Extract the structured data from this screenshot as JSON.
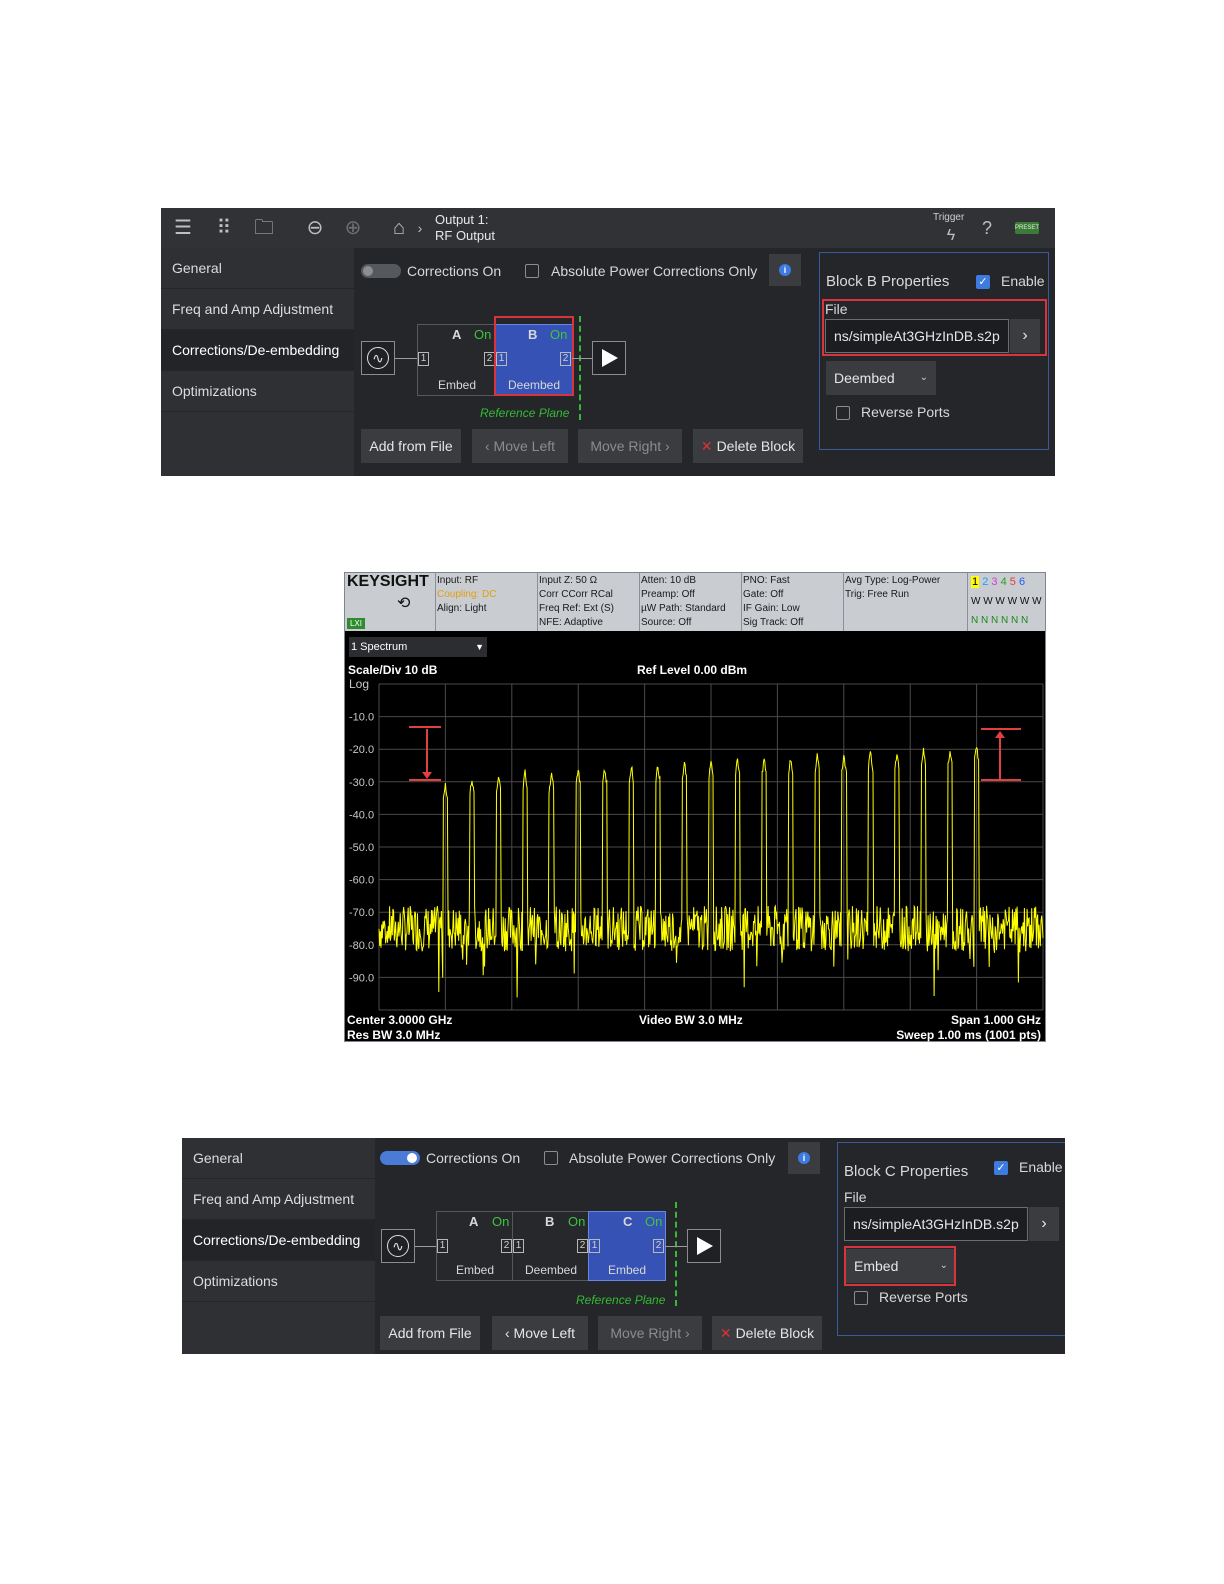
{
  "panel1": {
    "topbar": {
      "output_line1": "Output 1:",
      "output_line2": "RF Output",
      "trigger_label": "Trigger",
      "help_glyph": "?",
      "preset_label": "PRESET"
    },
    "side_items": [
      "General",
      "Freq and Amp Adjustment",
      "Corrections/De-embedding",
      "Optimizations"
    ],
    "corrections_on_label": "Corrections On",
    "corrections_on": false,
    "abs_power_label": "Absolute Power Corrections Only",
    "info_glyph": "i",
    "blocks": [
      {
        "letter": "A",
        "status": "On",
        "mode": "Embed",
        "port_in": "1",
        "port_out": "2"
      },
      {
        "letter": "B",
        "status": "On",
        "mode": "Deembed",
        "port_in": "1",
        "port_out": "2"
      }
    ],
    "reference_plane": "Reference Plane",
    "buttons": {
      "add": "Add from File",
      "move_left": "Move Left",
      "move_right": "Move Right",
      "delete": "Delete Block"
    },
    "props": {
      "title": "Block B Properties",
      "enable_label": "Enable",
      "file_label": "File",
      "file_value": "ns/simpleAt3GHzInDB.s2p",
      "mode_value": "Deembed",
      "reverse_label": "Reverse Ports"
    }
  },
  "spectrum": {
    "brand": "KEYSIGHT",
    "lxi": "LXI",
    "col1": [
      "Input: RF",
      "Coupling: DC",
      "Align: Light"
    ],
    "col2": [
      "Input Z: 50 Ω",
      "Corr CCorr RCal",
      "Freq Ref: Ext (S)",
      "NFE: Adaptive"
    ],
    "col3": [
      "Atten: 10 dB",
      "Preamp: Off",
      "µW Path: Standard",
      "Source: Off"
    ],
    "col4": [
      "PNO: Fast",
      "Gate: Off",
      "IF Gain: Low",
      "Sig Track: Off"
    ],
    "col5": [
      "Avg Type: Log-Power",
      "Trig: Free Run"
    ],
    "trace_numbers": [
      "1",
      "2",
      "3",
      "4",
      "5",
      "6"
    ],
    "trace_types": "W W W W W W",
    "trace_detect": "N N N N N N",
    "window_title": "1 Spectrum",
    "scale": "Scale/Div 10 dB",
    "log_label": "Log",
    "ref_level": "Ref Level 0.00 dBm",
    "center": "Center 3.0000 GHz",
    "res_bw": "Res BW 3.0 MHz",
    "video_bw": "Video BW 3.0 MHz",
    "span": "Span 1.000 GHz",
    "sweep": "Sweep 1.00 ms (1001 pts)",
    "colors": {
      "trace": "#ffff00",
      "grid": "#4a4a4a",
      "marker": "#e04040"
    },
    "chart_data": {
      "type": "line",
      "title": "1 Spectrum",
      "xlabel": "",
      "ylabel": "",
      "ylim": [
        -100,
        0
      ],
      "y_ticks": [
        "-10.0",
        "-20.0",
        "-30.0",
        "-40.0",
        "-50.0",
        "-60.0",
        "-70.0",
        "-80.0",
        "-90.0"
      ],
      "x_range_ghz": [
        2.5,
        3.5
      ],
      "noise_floor_dbm": -75,
      "tones": {
        "x_ghz": [
          2.6,
          2.64,
          2.68,
          2.72,
          2.76,
          2.8,
          2.84,
          2.88,
          2.92,
          2.96,
          3.0,
          3.04,
          3.08,
          3.12,
          3.16,
          3.2,
          3.24,
          3.28,
          3.32,
          3.36,
          3.4
        ],
        "peak_dbm": [
          -30,
          -28,
          -27,
          -26,
          -26,
          -25,
          -25,
          -24,
          -24,
          -23,
          -23,
          -22,
          -22,
          -22,
          -21,
          -21,
          -20,
          -20,
          -19,
          -19,
          -18
        ]
      }
    }
  },
  "panel2": {
    "side_items": [
      "General",
      "Freq and Amp Adjustment",
      "Corrections/De-embedding",
      "Optimizations"
    ],
    "corrections_on_label": "Corrections On",
    "corrections_on": true,
    "abs_power_label": "Absolute Power Corrections Only",
    "info_glyph": "i",
    "blocks": [
      {
        "letter": "A",
        "status": "On",
        "mode": "Embed",
        "port_in": "1",
        "port_out": "2"
      },
      {
        "letter": "B",
        "status": "On",
        "mode": "Deembed",
        "port_in": "1",
        "port_out": "2"
      },
      {
        "letter": "C",
        "status": "On",
        "mode": "Embed",
        "port_in": "1",
        "port_out": "2"
      }
    ],
    "reference_plane": "Reference Plane",
    "buttons": {
      "add": "Add from File",
      "move_left": "Move Left",
      "move_right": "Move Right",
      "delete": "Delete Block"
    },
    "props": {
      "title": "Block C Properties",
      "enable_label": "Enable",
      "file_label": "File",
      "file_value": "ns/simpleAt3GHzInDB.s2p",
      "mode_value": "Embed",
      "reverse_label": "Reverse Ports"
    }
  }
}
